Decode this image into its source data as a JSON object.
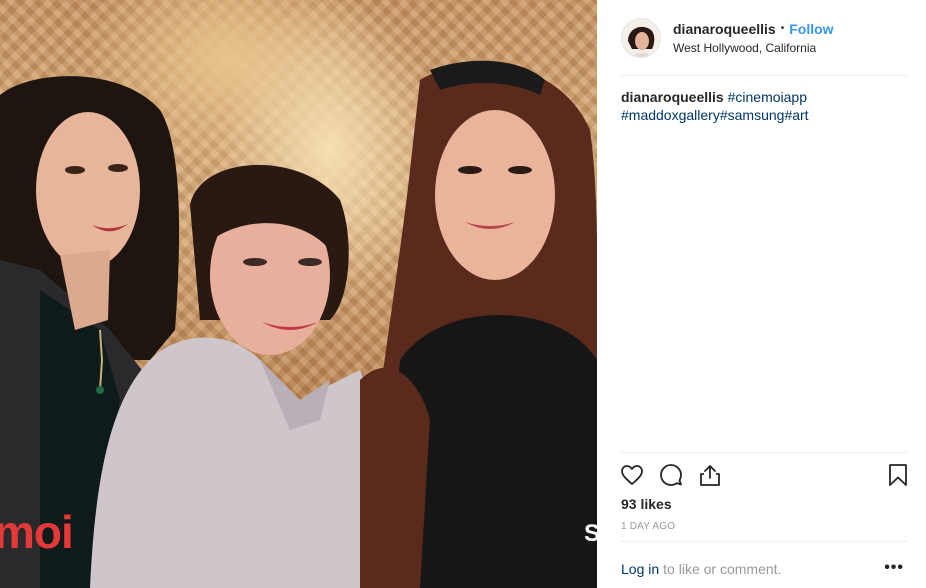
{
  "post": {
    "username": "dianaroqueellis",
    "separator": "•",
    "follow_label": "Follow",
    "location": "West Hollywood, California"
  },
  "caption": {
    "username": "dianaroqueellis",
    "hashtags_line1": "#cinemoiapp",
    "hashtags_line2": [
      "#maddoxgallery",
      "#samsung",
      "#art"
    ]
  },
  "icons": {
    "like": "heart-icon",
    "comment": "comment-icon",
    "share": "share-icon",
    "save": "bookmark-icon",
    "more": "more-options-icon"
  },
  "engagement": {
    "likes": "93 likes",
    "time_ago": "1 DAY AGO"
  },
  "comment_bar": {
    "login_link": "Log in",
    "login_rest": "to like or comment.",
    "more_label": "•••"
  },
  "photo": {
    "watermark_left": "moi",
    "watermark_right": "S"
  },
  "colors": {
    "link_blue": "#3897f0",
    "hashtag": "#003569",
    "muted": "#999999",
    "text": "#262626"
  }
}
